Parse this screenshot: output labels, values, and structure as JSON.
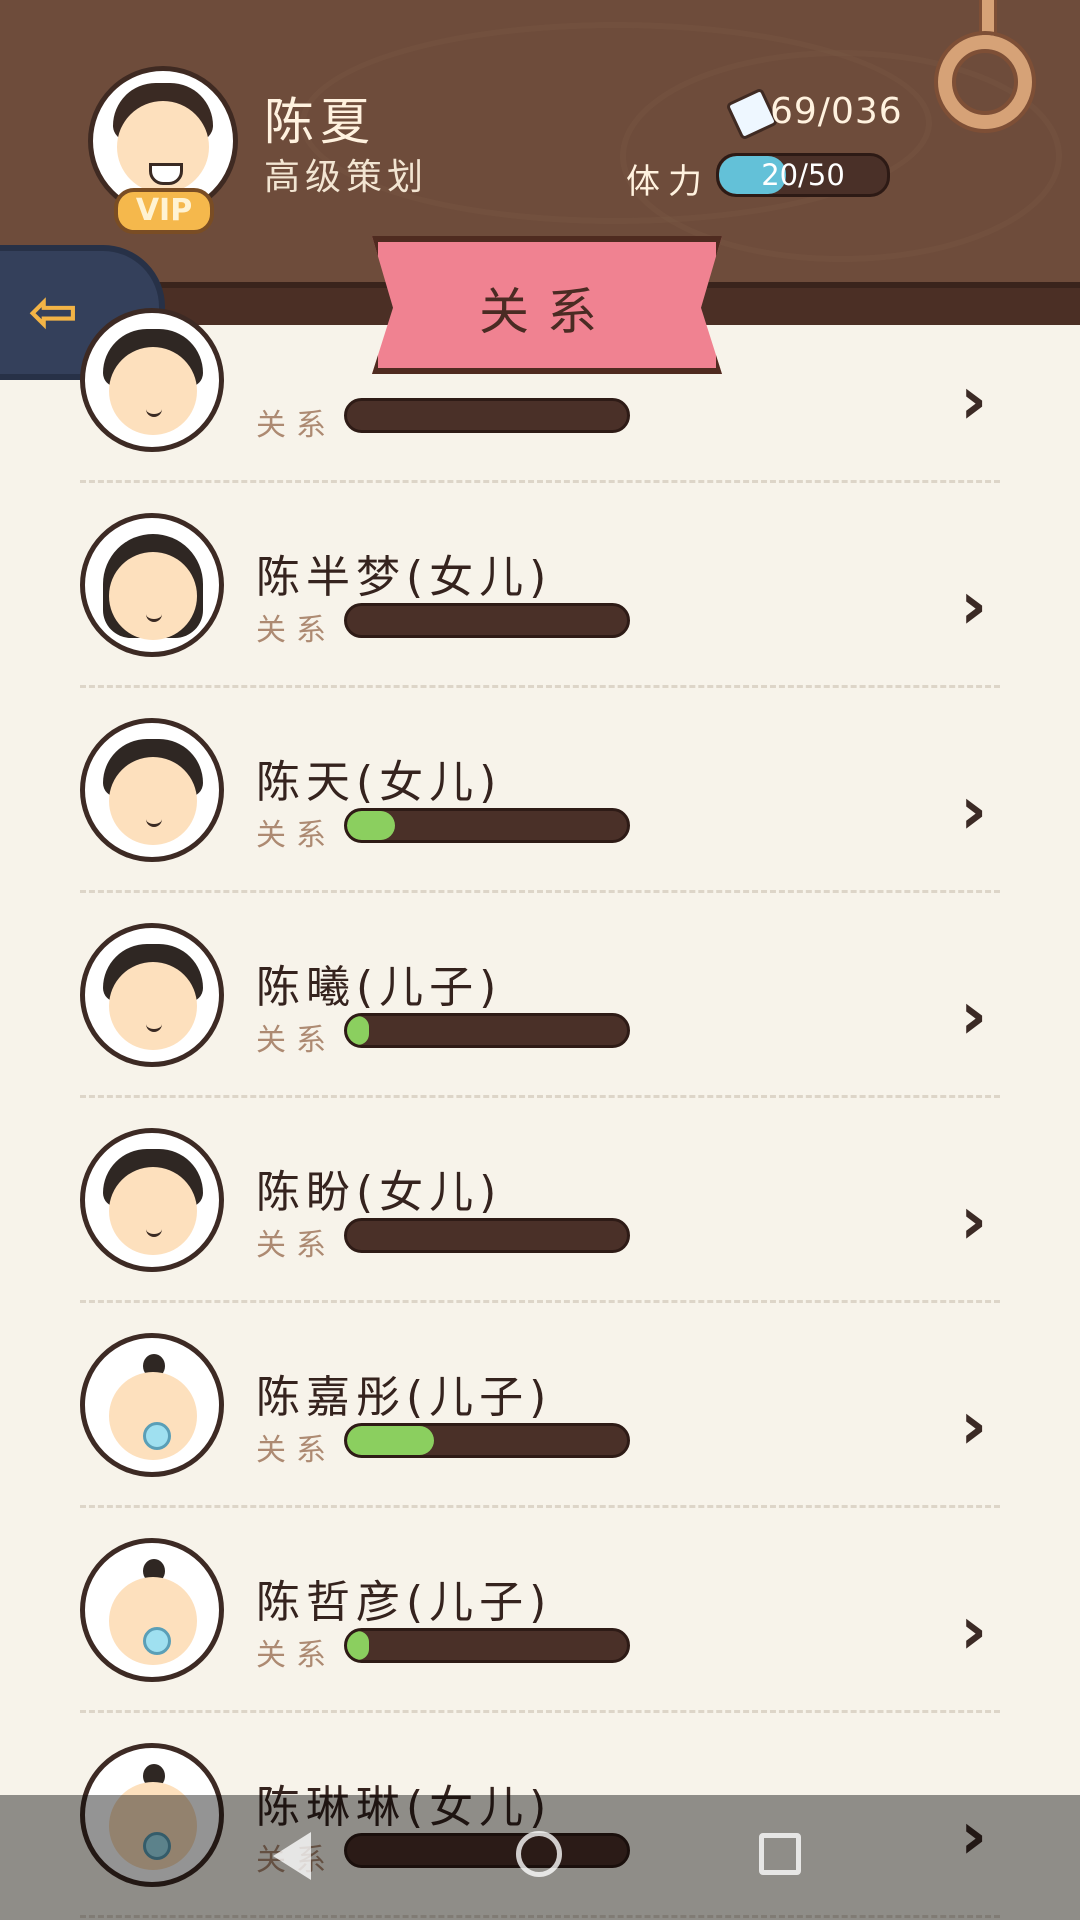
{
  "header": {
    "name": "陈夏",
    "title": "高级策划",
    "vip": "VIP",
    "money": "69/036",
    "stamina_label": "体力",
    "stamina_value": "20/50",
    "stamina_fraction": 0.4,
    "banner": "关系"
  },
  "list": {
    "rel_label": "关系",
    "items": [
      {
        "name": "",
        "relation": 0.0,
        "avatar": "partial"
      },
      {
        "name": "陈半梦(女儿)",
        "relation": 0.0,
        "avatar": "girl-long"
      },
      {
        "name": "陈天(女儿)",
        "relation": 0.17,
        "avatar": "girl-short"
      },
      {
        "name": "陈曦(儿子)",
        "relation": 0.08,
        "avatar": "boy"
      },
      {
        "name": "陈盼(女儿)",
        "relation": 0.0,
        "avatar": "girl-short"
      },
      {
        "name": "陈嘉彤(儿子)",
        "relation": 0.31,
        "avatar": "baby"
      },
      {
        "name": "陈哲彦(儿子)",
        "relation": 0.08,
        "avatar": "baby"
      },
      {
        "name": "陈琳琳(女儿)",
        "relation": 0.0,
        "avatar": "baby"
      }
    ]
  },
  "colors": {
    "header": "#6e4c3b",
    "banner": "#f08291",
    "stamina": "#63c1d8",
    "relation_fill": "#8bcf5f",
    "page_bg": "#f7f3ea"
  },
  "icons": {
    "back": "left-arrow-icon",
    "money": "money-note-icon",
    "row_chevron": "chevron-right-icon"
  }
}
